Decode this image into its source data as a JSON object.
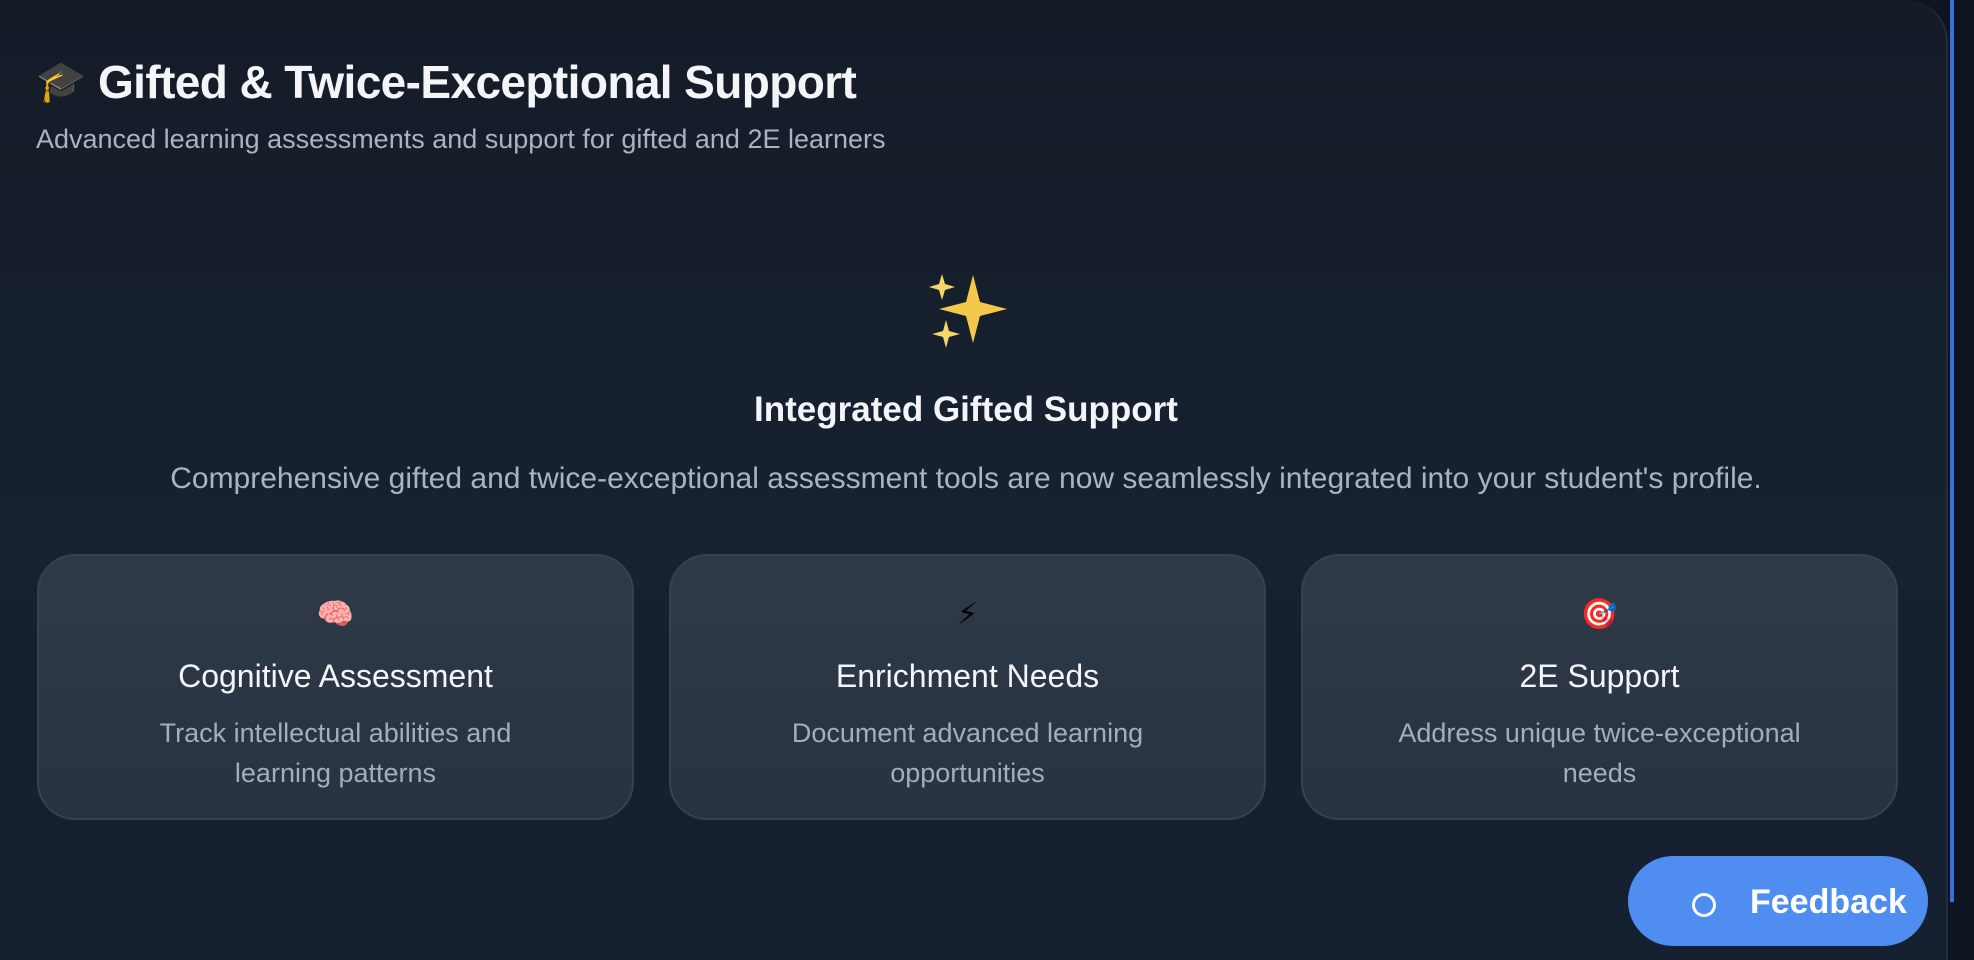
{
  "header": {
    "icon": "graduation-cap-icon",
    "icon_glyph": "🎓",
    "title": "Gifted & Twice-Exceptional Support",
    "subtitle": "Advanced learning assessments and support for gifted and 2E learners"
  },
  "hero": {
    "icon": "sparkles-icon",
    "title": "Integrated Gifted Support",
    "description": "Comprehensive gifted and twice-exceptional assessment tools are now seamlessly integrated into your student's profile."
  },
  "cards": [
    {
      "icon": "brain-icon",
      "glyph": "🧠",
      "title": "Cognitive Assessment",
      "description": "Track intellectual abilities and learning patterns"
    },
    {
      "icon": "lightning-icon",
      "glyph": "⚡",
      "title": "Enrichment Needs",
      "description": "Document advanced learning opportunities"
    },
    {
      "icon": "target-icon",
      "glyph": "🎯",
      "title": "2E Support",
      "description": "Address unique twice-exceptional needs"
    }
  ],
  "feedback": {
    "icon": "chat-bubble-icon",
    "label": "Feedback"
  },
  "colors": {
    "background": "#151c28",
    "card": "#2f3a48",
    "accent": "#4f8df1",
    "sparkle": "#f4c84a"
  }
}
